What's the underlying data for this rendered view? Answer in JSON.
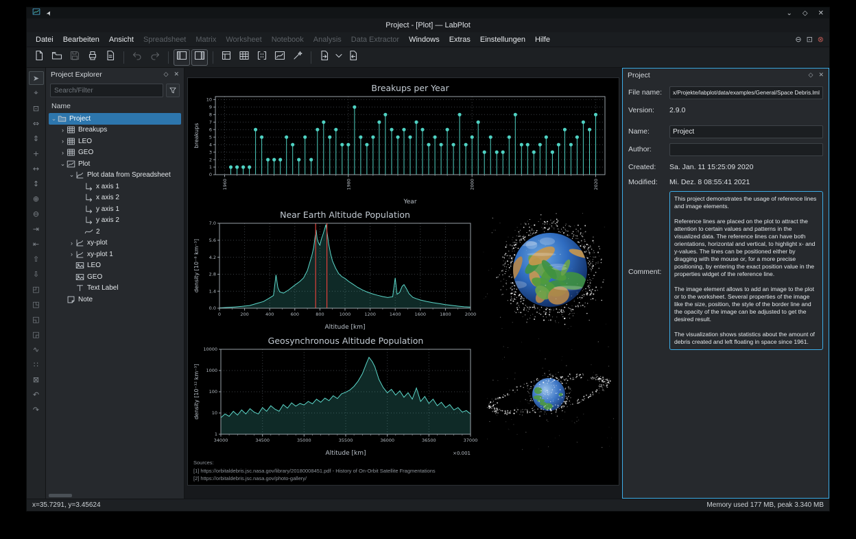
{
  "window": {
    "title": "Project - [Plot] — LabPlot",
    "controls": {
      "shade": "⌄",
      "maximize": "◇",
      "close": "✕"
    },
    "mdi_controls": [
      "⊖",
      "⊡",
      "⊗"
    ]
  },
  "menubar": {
    "items": [
      {
        "label": "Datei",
        "enabled": true
      },
      {
        "label": "Bearbeiten",
        "enabled": true
      },
      {
        "label": "Ansicht",
        "enabled": true
      },
      {
        "label": "Spreadsheet",
        "enabled": false
      },
      {
        "label": "Matrix",
        "enabled": false
      },
      {
        "label": "Worksheet",
        "enabled": false
      },
      {
        "label": "Notebook",
        "enabled": false
      },
      {
        "label": "Analysis",
        "enabled": false
      },
      {
        "label": "Data Extractor",
        "enabled": false
      },
      {
        "label": "Windows",
        "enabled": true
      },
      {
        "label": "Extras",
        "enabled": true
      },
      {
        "label": "Einstellungen",
        "enabled": true
      },
      {
        "label": "Hilfe",
        "enabled": true
      }
    ]
  },
  "toolbar": {
    "buttons": [
      {
        "name": "new-project-button",
        "icon": "file-new"
      },
      {
        "name": "open-project-button",
        "icon": "folder-open"
      },
      {
        "name": "save-project-button",
        "icon": "save",
        "disabled": true
      },
      {
        "name": "print-button",
        "icon": "print"
      },
      {
        "name": "print-preview-button",
        "icon": "page"
      },
      {
        "sep": true
      },
      {
        "name": "undo-button",
        "icon": "undo",
        "disabled": true
      },
      {
        "name": "redo-button",
        "icon": "redo",
        "disabled": true
      },
      {
        "sep": true
      },
      {
        "name": "toggle-project-explorer-button",
        "icon": "panel-left",
        "pressed": true
      },
      {
        "name": "toggle-properties-explorer-button",
        "icon": "panel-right",
        "pressed": true
      },
      {
        "sep": true
      },
      {
        "name": "new-workbook-button",
        "icon": "workbook"
      },
      {
        "name": "new-spreadsheet-button",
        "icon": "spreadsheet"
      },
      {
        "name": "new-matrix-button",
        "icon": "matrix"
      },
      {
        "name": "new-worksheet-button",
        "icon": "worksheet"
      },
      {
        "name": "new-notebook-button",
        "icon": "wand"
      },
      {
        "sep": true
      },
      {
        "name": "import-file-button",
        "icon": "file-import"
      },
      {
        "name": "import-dropdown-button",
        "icon": "chevron-down",
        "narrow": true
      },
      {
        "name": "export-button",
        "icon": "file-export"
      }
    ]
  },
  "left_toolbar": {
    "tools": [
      {
        "name": "select-tool",
        "glyph": "➤",
        "active": true
      },
      {
        "name": "crosshair-tool",
        "glyph": "⌖"
      },
      {
        "name": "zoom-select-tool",
        "glyph": "⊡"
      },
      {
        "name": "zoom-x-select-tool",
        "glyph": "⇔"
      },
      {
        "name": "zoom-y-select-tool",
        "glyph": "⇕"
      },
      {
        "name": "auto-scale-tool",
        "glyph": "+"
      },
      {
        "name": "auto-scale-x-tool",
        "glyph": "↔"
      },
      {
        "name": "auto-scale-y-tool",
        "glyph": "↕"
      },
      {
        "name": "zoom-in-tool",
        "glyph": "⊕"
      },
      {
        "name": "zoom-out-tool",
        "glyph": "⊖"
      },
      {
        "name": "zoom-in-x-tool",
        "glyph": "⇥"
      },
      {
        "name": "zoom-out-x-tool",
        "glyph": "⇤"
      },
      {
        "name": "zoom-in-y-tool",
        "glyph": "⇧"
      },
      {
        "name": "zoom-out-y-tool",
        "glyph": "⇩"
      },
      {
        "name": "shift-left-x-tool",
        "glyph": "◰"
      },
      {
        "name": "shift-right-x-tool",
        "glyph": "◳"
      },
      {
        "name": "shift-up-y-tool",
        "glyph": "◱"
      },
      {
        "name": "shift-down-y-tool",
        "glyph": "◲"
      },
      {
        "name": "add-curve-tool",
        "glyph": "∿"
      },
      {
        "name": "add-grid-tool",
        "glyph": "∷"
      },
      {
        "name": "delete-element-tool",
        "glyph": "⊠"
      },
      {
        "name": "back-tool",
        "glyph": "↶"
      },
      {
        "name": "forward-tool",
        "glyph": "↷"
      }
    ]
  },
  "project_explorer": {
    "title": "Project Explorer",
    "float_glyph": "◇",
    "close_glyph": "✕",
    "search_placeholder": "Search/Filter",
    "column_header": "Name",
    "tree": [
      {
        "label": "Project",
        "depth": 0,
        "icon": "folder",
        "chev": "open",
        "selected": true
      },
      {
        "label": "Breakups",
        "depth": 1,
        "icon": "spreadsheet",
        "chev": "closed"
      },
      {
        "label": "LEO",
        "depth": 1,
        "icon": "spreadsheet",
        "chev": "closed"
      },
      {
        "label": "GEO",
        "depth": 1,
        "icon": "spreadsheet",
        "chev": "closed"
      },
      {
        "label": "Plot",
        "depth": 1,
        "icon": "worksheet",
        "chev": "open"
      },
      {
        "label": "Plot data from Spreadsheet",
        "depth": 2,
        "icon": "xy-plot",
        "chev": "open"
      },
      {
        "label": "x axis 1",
        "depth": 3,
        "icon": "axis",
        "chev": "none"
      },
      {
        "label": "x axis 2",
        "depth": 3,
        "icon": "axis",
        "chev": "none"
      },
      {
        "label": "y axis 1",
        "depth": 3,
        "icon": "axis",
        "chev": "none"
      },
      {
        "label": "y axis 2",
        "depth": 3,
        "icon": "axis",
        "chev": "none"
      },
      {
        "label": "2",
        "depth": 3,
        "icon": "curve",
        "chev": "none"
      },
      {
        "label": "xy-plot",
        "depth": 2,
        "icon": "xy-plot",
        "chev": "closed"
      },
      {
        "label": "xy-plot 1",
        "depth": 2,
        "icon": "xy-plot",
        "chev": "closed"
      },
      {
        "label": "LEO",
        "depth": 2,
        "icon": "image",
        "chev": "none"
      },
      {
        "label": "GEO",
        "depth": 2,
        "icon": "image",
        "chev": "none"
      },
      {
        "label": "Text Label",
        "depth": 2,
        "icon": "text-label",
        "chev": "none"
      },
      {
        "label": "Note",
        "depth": 1,
        "icon": "note",
        "chev": "none"
      }
    ]
  },
  "worksheet": {
    "sources": [
      "Sources:",
      "[1] https://orbitaldebris.jsc.nasa.gov/library/20180008451.pdf - History of On-Orbit Satellite Fragmentations",
      "[2] https://orbitaldebris.jsc.nasa.gov/photo-gallery/"
    ]
  },
  "chart_data": [
    {
      "type": "stem",
      "title": "Breakups per Year",
      "xlabel": "Year",
      "ylabel": "breakups",
      "xlim": [
        1958.5,
        2021.5
      ],
      "ylim": [
        0,
        10.4
      ],
      "xticks": [
        1960,
        1980,
        2000,
        2020
      ],
      "xtick_labels": [
        "1960",
        "1980",
        "2000",
        "2020"
      ],
      "xtick_minor": [
        1960,
        2020,
        2
      ],
      "yticks": [
        0,
        1,
        2,
        3,
        4,
        5,
        6,
        7,
        8,
        9,
        10
      ],
      "x": [
        1961,
        1962,
        1963,
        1964,
        1965,
        1966,
        1967,
        1968,
        1969,
        1970,
        1971,
        1972,
        1973,
        1974,
        1975,
        1976,
        1977,
        1978,
        1979,
        1980,
        1981,
        1982,
        1983,
        1984,
        1985,
        1986,
        1987,
        1988,
        1989,
        1990,
        1991,
        1992,
        1993,
        1994,
        1995,
        1996,
        1997,
        1998,
        1999,
        2000,
        2001,
        2002,
        2003,
        2004,
        2005,
        2006,
        2007,
        2008,
        2009,
        2010,
        2011,
        2012,
        2013,
        2014,
        2015,
        2016,
        2017,
        2018,
        2019,
        2020
      ],
      "values": [
        1,
        1,
        1,
        1,
        6,
        5,
        2,
        2,
        2,
        5,
        4,
        2,
        5,
        2,
        6,
        7,
        5,
        6,
        4,
        4,
        9,
        5,
        4,
        5,
        7,
        8,
        6,
        5,
        6,
        5,
        7,
        6,
        4,
        5,
        4,
        6,
        4,
        8,
        4,
        5,
        7,
        3,
        5,
        3,
        3,
        5,
        8,
        4,
        4,
        3,
        4,
        5,
        3,
        4,
        6,
        4,
        5,
        7,
        6,
        8
      ]
    },
    {
      "type": "area",
      "title": "Near Earth Altitude Population",
      "xlabel": "Altitude [km]",
      "ylabel": "density [10⁻⁸ km⁻³]",
      "xlim": [
        0,
        2000
      ],
      "ylim": [
        0,
        7.0
      ],
      "xticks": [
        0,
        200,
        400,
        600,
        800,
        1000,
        1200,
        1400,
        1600,
        1800,
        2000
      ],
      "xtick_labels": [
        "0",
        "200",
        "400",
        "600",
        "800",
        "1000",
        "1200",
        "1400",
        "1600",
        "1800",
        "2000"
      ],
      "xtick_minor": [
        0,
        2000,
        100
      ],
      "yticks": [
        0,
        1.4,
        2.8,
        4.2,
        5.6,
        7.0
      ],
      "ytick_labels": [
        "0.0",
        "1.4",
        "2.8",
        "4.2",
        "5.6",
        "7.0"
      ],
      "reference_lines_x": [
        766,
        856
      ],
      "points": [
        [
          0,
          0.03
        ],
        [
          60,
          0.06
        ],
        [
          120,
          0.1
        ],
        [
          180,
          0.15
        ],
        [
          240,
          0.22
        ],
        [
          300,
          0.4
        ],
        [
          350,
          0.55
        ],
        [
          400,
          0.85
        ],
        [
          430,
          1.05
        ],
        [
          450,
          2.75
        ],
        [
          465,
          1.7
        ],
        [
          480,
          1.35
        ],
        [
          510,
          1.25
        ],
        [
          550,
          1.5
        ],
        [
          600,
          1.9
        ],
        [
          640,
          2.2
        ],
        [
          670,
          2.5
        ],
        [
          700,
          3.1
        ],
        [
          720,
          3.8
        ],
        [
          735,
          4.3
        ],
        [
          750,
          5.0
        ],
        [
          762,
          5.9
        ],
        [
          770,
          6.45
        ],
        [
          778,
          5.7
        ],
        [
          790,
          5.35
        ],
        [
          800,
          5.2
        ],
        [
          812,
          5.7
        ],
        [
          825,
          6.1
        ],
        [
          838,
          6.55
        ],
        [
          848,
          6.9
        ],
        [
          858,
          6.2
        ],
        [
          870,
          5.3
        ],
        [
          885,
          4.5
        ],
        [
          900,
          3.9
        ],
        [
          925,
          3.3
        ],
        [
          950,
          2.85
        ],
        [
          975,
          2.6
        ],
        [
          1000,
          2.45
        ],
        [
          1030,
          2.2
        ],
        [
          1060,
          2.0
        ],
        [
          1100,
          1.72
        ],
        [
          1140,
          1.5
        ],
        [
          1180,
          1.32
        ],
        [
          1220,
          1.18
        ],
        [
          1260,
          1.06
        ],
        [
          1300,
          0.96
        ],
        [
          1340,
          0.88
        ],
        [
          1380,
          0.95
        ],
        [
          1400,
          2.5
        ],
        [
          1415,
          1.15
        ],
        [
          1435,
          1.3
        ],
        [
          1455,
          1.8
        ],
        [
          1470,
          1.95
        ],
        [
          1490,
          1.6
        ],
        [
          1510,
          1.2
        ],
        [
          1540,
          0.9
        ],
        [
          1570,
          0.78
        ],
        [
          1600,
          0.68
        ],
        [
          1650,
          0.56
        ],
        [
          1700,
          0.46
        ],
        [
          1750,
          0.38
        ],
        [
          1800,
          0.3
        ],
        [
          1850,
          0.23
        ],
        [
          1900,
          0.17
        ],
        [
          1950,
          0.12
        ],
        [
          2000,
          0.09
        ]
      ]
    },
    {
      "type": "area",
      "yscale": "log",
      "title": "Geosynchronous Altitude Population",
      "xlabel": "Altitude [km]",
      "ylabel": "density [10⁻¹² km⁻³]",
      "x_scale_note": "×0.001",
      "xlim": [
        34000,
        37000
      ],
      "ylim": [
        1,
        10000
      ],
      "xticks": [
        34000,
        34500,
        35000,
        35500,
        36000,
        36500,
        37000
      ],
      "xtick_labels": [
        "34000",
        "34500",
        "35000",
        "35500",
        "36000",
        "36500",
        "37000"
      ],
      "xtick_minor": [
        34000,
        37000,
        100
      ],
      "yticks": [
        1,
        10,
        100,
        1000,
        10000
      ],
      "ytick_labels": [
        "1",
        "10",
        "100",
        "1000",
        "10000"
      ],
      "points": [
        [
          34000,
          6
        ],
        [
          34050,
          9
        ],
        [
          34100,
          7
        ],
        [
          34150,
          12
        ],
        [
          34200,
          8
        ],
        [
          34250,
          14
        ],
        [
          34300,
          9
        ],
        [
          34350,
          16
        ],
        [
          34400,
          11
        ],
        [
          34450,
          9
        ],
        [
          34500,
          18
        ],
        [
          34550,
          12
        ],
        [
          34600,
          22
        ],
        [
          34650,
          15
        ],
        [
          34700,
          12
        ],
        [
          34750,
          25
        ],
        [
          34800,
          17
        ],
        [
          34850,
          30
        ],
        [
          34900,
          21
        ],
        [
          34950,
          28
        ],
        [
          35000,
          24
        ],
        [
          35050,
          35
        ],
        [
          35100,
          27
        ],
        [
          35150,
          45
        ],
        [
          35200,
          32
        ],
        [
          35250,
          50
        ],
        [
          35300,
          38
        ],
        [
          35350,
          65
        ],
        [
          35400,
          48
        ],
        [
          35450,
          80
        ],
        [
          35500,
          95
        ],
        [
          35550,
          120
        ],
        [
          35600,
          180
        ],
        [
          35650,
          320
        ],
        [
          35700,
          700
        ],
        [
          35750,
          2200
        ],
        [
          35780,
          4200
        ],
        [
          35820,
          2600
        ],
        [
          35850,
          1500
        ],
        [
          35900,
          380
        ],
        [
          35950,
          160
        ],
        [
          36000,
          90
        ],
        [
          36050,
          130
        ],
        [
          36100,
          70
        ],
        [
          36150,
          110
        ],
        [
          36200,
          55
        ],
        [
          36250,
          90
        ],
        [
          36300,
          45
        ],
        [
          36350,
          150
        ],
        [
          36400,
          35
        ],
        [
          36450,
          60
        ],
        [
          36500,
          28
        ],
        [
          36550,
          45
        ],
        [
          36600,
          22
        ],
        [
          36650,
          32
        ],
        [
          36700,
          18
        ],
        [
          36750,
          25
        ],
        [
          36800,
          14
        ],
        [
          36850,
          18
        ],
        [
          36900,
          11
        ],
        [
          36950,
          13
        ],
        [
          37000,
          9
        ]
      ]
    }
  ],
  "properties_panel": {
    "title": "Project",
    "float_glyph": "◇",
    "close_glyph": "✕",
    "fields": {
      "file_name_label": "File name:",
      "file_name": "x/Projekte/labplot/data/examples/General/Space Debris.lml",
      "version_label": "Version:",
      "version": "2.9.0",
      "name_label": "Name:",
      "name": "Project",
      "author_label": "Author:",
      "author": "",
      "created_label": "Created:",
      "created": "Sa. Jan. 11 15:25:09 2020",
      "modified_label": "Modified:",
      "modified": "Mi. Dez. 8 08:55:41 2021",
      "comment_label": "Comment:",
      "comment": "This project demonstrates the usage of reference lines and image elements.\n\nReference lines are placed on the plot to attract the attention to certain values and patterns in the visualized data. The reference lines can have both orientations, horizontal and vertical, to highlight x- and y-values. The lines can be positioned either by dragging with the mouse or, for a more precise positioning, by entering the exact position value in the properties widget of the reference line.\n\nThe image element allows to add an image to the plot or to the worksheet. Several properties of the image like the size, position, the style of the border line and the opacity of the image can be adjusted to get the desired result.\n\nThe visualization shows statistics about the amount of debris created and left floating in space since 1961."
    }
  },
  "statusbar": {
    "coordinates": "x=35.7291, y=3.45624",
    "memory": "Memory used 177 MB, peak 3.340 MB"
  },
  "colors": {
    "accent": "#3daee9",
    "teal": "#4fd2c3",
    "red": "#e0413b",
    "grid": "#3b4045"
  }
}
